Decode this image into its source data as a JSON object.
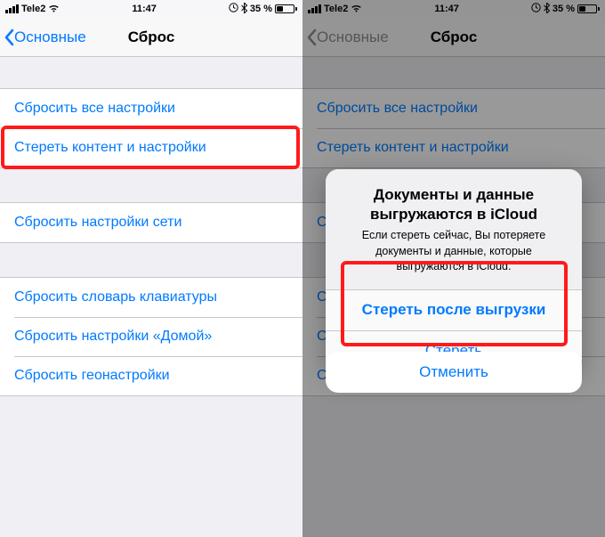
{
  "statusBar": {
    "carrier": "Tele2",
    "wifiIcon": "wifi",
    "time": "11:47",
    "orientationLockIcon": "orientation-lock",
    "btIcon": "bluetooth",
    "batteryPercent": "35 %"
  },
  "nav": {
    "backLabel": "Основные",
    "title": "Сброс"
  },
  "group1": {
    "resetAll": "Сбросить все настройки",
    "eraseAll": "Стереть контент и настройки"
  },
  "group2": {
    "resetNetwork": "Сбросить настройки сети"
  },
  "group3": {
    "resetKeyboard": "Сбросить словарь клавиатуры",
    "resetHome": "Сбросить настройки «Домой»",
    "resetLocation": "Сбросить геонастройки"
  },
  "alert": {
    "title": "Документы и данные выгружаются в iCloud",
    "message": "Если стереть сейчас, Вы потеряете документы и данные, которые выгружаются в iCloud.",
    "eraseAfterUpload": "Стереть после выгрузки",
    "eraseNow": "Стереть",
    "cancel": "Отменить"
  }
}
